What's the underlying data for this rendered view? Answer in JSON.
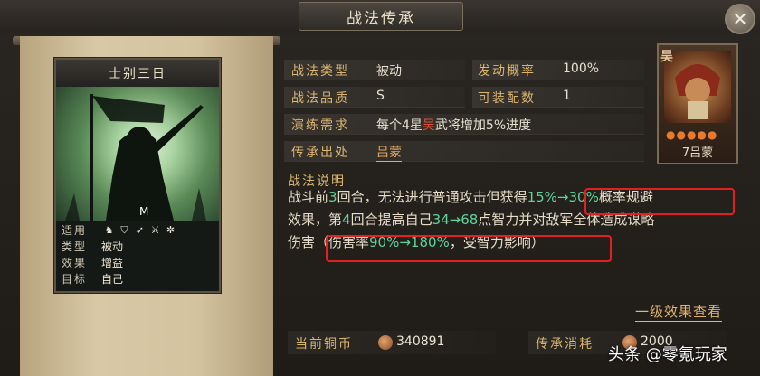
{
  "header": {
    "title": "战法传承"
  },
  "card": {
    "name": "士别三日",
    "signature": "M",
    "info": [
      {
        "label": "适用",
        "value": ""
      },
      {
        "label": "类型",
        "value": "被动"
      },
      {
        "label": "效果",
        "value": "增益"
      },
      {
        "label": "目标",
        "value": "自己"
      }
    ],
    "applicable_icons": [
      "cavalry-icon",
      "shield-icon",
      "bow-icon",
      "sword-icon",
      "wheel-icon"
    ]
  },
  "details": {
    "type_label": "战法类型",
    "type_value": "被动",
    "chance_label": "发动概率",
    "chance_value": "100%",
    "quality_label": "战法品质",
    "quality_value": "S",
    "slots_label": "可装配数",
    "slots_value": "1",
    "drill_label": "演练需求",
    "drill_pre": "每个4星",
    "drill_camp": "吴",
    "drill_post": "武将增加5%进度",
    "source_label": "传承出处",
    "source_value": "吕蒙"
  },
  "description": {
    "label": "战法说明",
    "line1_a": "战斗前",
    "line1_num": "3",
    "line1_b": "回合，无法进行普通攻击但获得",
    "line1_green": "15%→30%",
    "line1_c": "概率规避",
    "line2_a": "效果，第",
    "line2_num": "4",
    "line2_b": "回合提高自己",
    "line2_green": "34→68",
    "line2_c": "点智力并对敌军全体造成谋略",
    "line3_a": "伤害（伤害率",
    "line3_green": "90%→180%",
    "line3_c": "，受智力影响）"
  },
  "portrait": {
    "camp": "吴",
    "stars": "●●●●●",
    "name": "7吕蒙"
  },
  "level_effect_link": "一级效果查看",
  "currency": {
    "label": "当前铜币",
    "value": "340891"
  },
  "cost": {
    "label": "传承消耗",
    "value": "2000"
  },
  "watermark": "头条 @零氪玩家",
  "colors": {
    "label_gold": "#dcb56e",
    "highlight": "#5fd39a",
    "camp_red": "#e2503a",
    "box_red": "#e41f1f"
  }
}
